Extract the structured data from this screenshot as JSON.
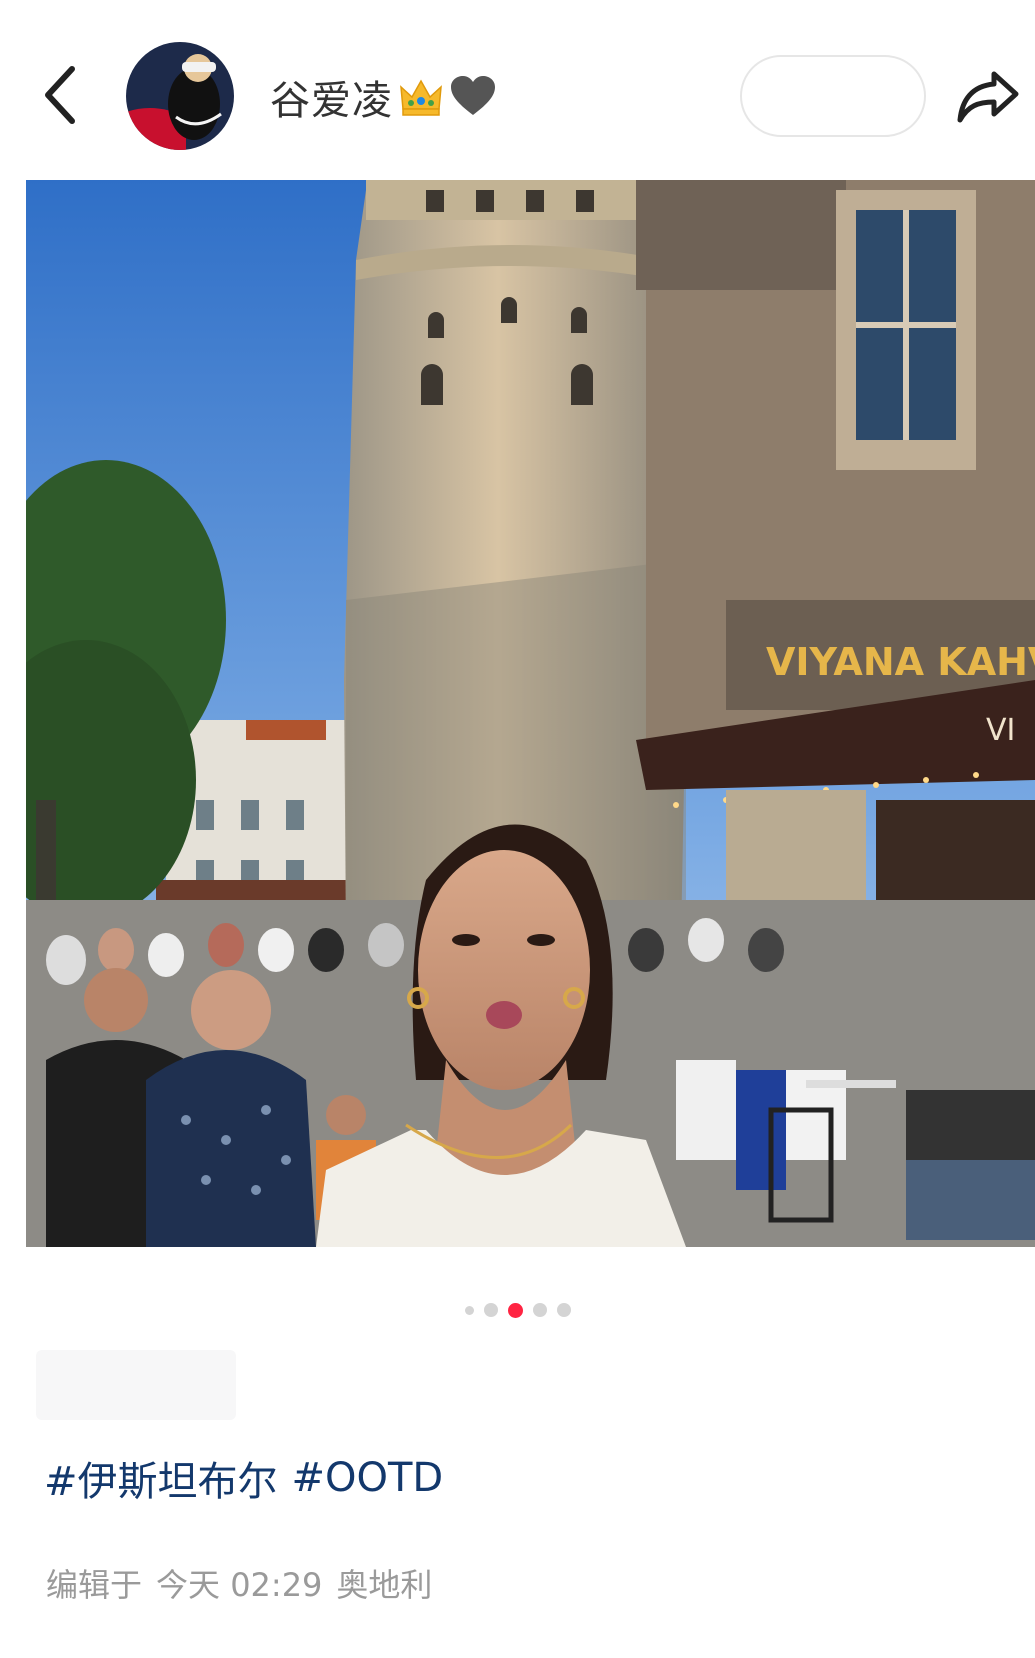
{
  "header": {
    "back_icon": "chevron-left-icon",
    "avatar_icon": "user-avatar",
    "username": "谷爱凌",
    "badges": [
      "crown-emoji",
      "black-heart-emoji"
    ],
    "follow_label": "",
    "share_icon": "share-arrow-icon"
  },
  "photo": {
    "description_icon": "post-photo",
    "sign_text": "VIYANA KAHVESİ",
    "sign_text_small": "VI"
  },
  "carousel": {
    "total": 5,
    "active_index": 2,
    "accent_color": "#ff2442"
  },
  "post": {
    "hashtags": [
      "#伊斯坦布尔",
      "#OOTD"
    ],
    "edited_label": "编辑于",
    "date": "今天 02:29",
    "location": "奥地利"
  },
  "colors": {
    "hashtag": "#13386c",
    "meta": "#9a9a9a",
    "background": "#ffffff"
  }
}
